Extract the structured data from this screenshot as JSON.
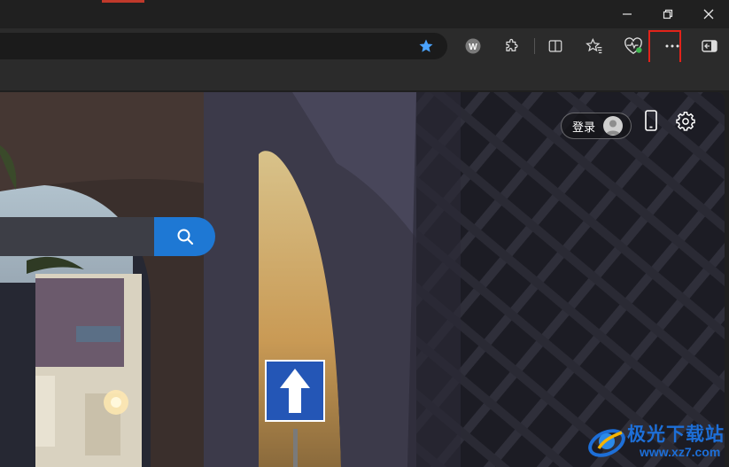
{
  "window": {
    "controls": {
      "minimize": "minimize-icon",
      "restore": "restore-icon",
      "close": "close-icon"
    }
  },
  "toolbar": {
    "icons": [
      "star-filled-icon",
      "w-extension-icon",
      "puzzle-extensions-icon",
      "split-screen-icon",
      "favorites-icon",
      "browser-essentials-icon",
      "more-options-icon",
      "sidebar-icon"
    ],
    "extension_letter": "W",
    "highlight_color": "#e2231a"
  },
  "page": {
    "login_label": "登录",
    "search_accent": "#1e78d4",
    "watermark": {
      "title": "极光下载站",
      "url": "www.xz7.com"
    }
  }
}
